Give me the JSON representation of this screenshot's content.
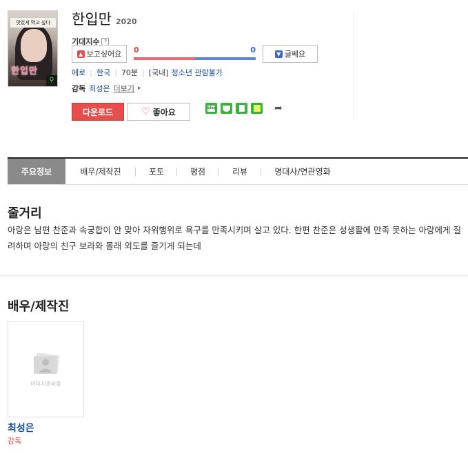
{
  "movie": {
    "title": "한입만",
    "year": "2020",
    "poster_top_text": "맛있게 먹고 싶다",
    "poster_title_text": "한입만"
  },
  "expectation": {
    "label": "기대지수",
    "help": "?",
    "want_label": "보고싶어요",
    "meh_label": "글쎄요",
    "want_count": "0",
    "meh_count": "0",
    "want_ratio": 0.5,
    "colors": {
      "want": "#e8696f",
      "meh": "#5a86d6"
    }
  },
  "meta": {
    "genre": "에로",
    "country": "한국",
    "runtime": "70분",
    "rating_prefix": "[국내]",
    "rating": "청소년 관람불가"
  },
  "director": {
    "label": "감독",
    "name": "최성은",
    "more": "더보기"
  },
  "actions": {
    "download": "다운로드",
    "like": "좋아요",
    "blog_icon_text": "blog"
  },
  "tabs": [
    {
      "label": "주요정보"
    },
    {
      "label": "배우/제작진"
    },
    {
      "label": "포토"
    },
    {
      "label": "평점"
    },
    {
      "label": "리뷰"
    },
    {
      "label": "명대사/연관영화"
    }
  ],
  "plot": {
    "title": "줄거리",
    "text": "아랑은 남편 찬준과 속궁합이 안 맞아 자위행위로 욕구를 만족시키며 살고 있다. 한편 찬준은 성생활에 만족 못하는 아랑에게 질려하며 아랑의 친구 보라와 몰래 외도를 즐기게 되는데"
  },
  "cast": {
    "title": "배우/제작진",
    "placeholder": "이미지준비중",
    "people": [
      {
        "name": "최성은",
        "role": "감독"
      }
    ]
  }
}
